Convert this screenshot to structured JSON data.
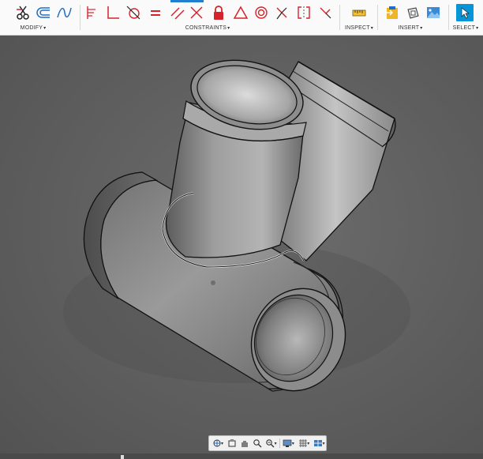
{
  "toolbar": {
    "groups": {
      "modify": "MODIFY",
      "constraints": "CONSTRAINTS",
      "inspect": "INSPECT",
      "insert": "INSERT",
      "select": "SELECT"
    },
    "caret": "▾",
    "accent_color": "#0696d7",
    "constraint_red": "#d4232b",
    "icons": {
      "modify": [
        "trim-icon",
        "offset-icon",
        "spline-icon"
      ],
      "constraints": [
        "dimension-icon",
        "coincident-icon",
        "tangent-icon",
        "equal-icon",
        "parallel-icon",
        "perpendicular-icon",
        "fix-icon",
        "triangle-icon",
        "concentric-icon",
        "midpoint-icon",
        "symmetry-icon",
        "smooth-icon"
      ],
      "inspect": [
        "measure-icon"
      ],
      "insert": [
        "insert-derive-icon",
        "decal-icon",
        "canvas-icon"
      ],
      "select": [
        "select-arrow-icon"
      ]
    }
  },
  "viewport": {
    "model": "pipe-wye-fitting",
    "background_color": "#5f5f5f"
  },
  "navbar": {
    "icons": [
      "orbit-icon",
      "look-at-icon",
      "pan-icon",
      "zoom-icon",
      "fit-icon",
      "display-settings-icon",
      "grid-icon",
      "viewports-icon"
    ]
  }
}
